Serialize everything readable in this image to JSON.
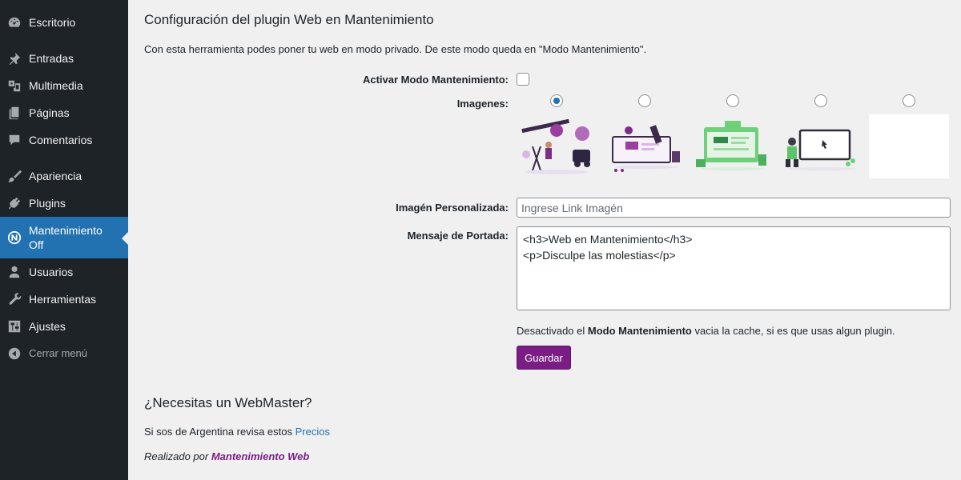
{
  "sidebar": {
    "items": [
      {
        "label": "Escritorio",
        "icon": "dashboard-icon"
      },
      {
        "label": "Entradas",
        "icon": "pin-icon"
      },
      {
        "label": "Multimedia",
        "icon": "media-icon"
      },
      {
        "label": "Páginas",
        "icon": "pages-icon"
      },
      {
        "label": "Comentarios",
        "icon": "comments-icon"
      },
      {
        "label": "Apariencia",
        "icon": "brush-icon"
      },
      {
        "label": "Plugins",
        "icon": "plugin-icon"
      },
      {
        "label": "Mantenimiento Off",
        "icon": "maintenance-icon"
      },
      {
        "label": "Usuarios",
        "icon": "users-icon"
      },
      {
        "label": "Herramientas",
        "icon": "wrench-icon"
      },
      {
        "label": "Ajustes",
        "icon": "settings-icon"
      },
      {
        "label": "Cerrar menú",
        "icon": "collapse-icon"
      }
    ],
    "active_color": "#2271b1"
  },
  "page": {
    "title": "Configuración del plugin Web en Mantenimiento",
    "description": "Con esta herramienta podes poner tu web en modo privado. De este modo queda en \"Modo Mantenimiento\".",
    "activate_label": "Activar Modo Mantenimiento:",
    "activate_checked": false,
    "images_label": "Imagenes:",
    "images": [
      {
        "name": "illustration-1",
        "selected": true
      },
      {
        "name": "illustration-2",
        "selected": false
      },
      {
        "name": "illustration-3",
        "selected": false
      },
      {
        "name": "illustration-4",
        "selected": false
      },
      {
        "name": "illustration-blank",
        "selected": false
      }
    ],
    "custom_image_label": "Imagén Personalizada:",
    "custom_image_placeholder": "Ingrese Link Imagén",
    "message_label": "Mensaje de Portada:",
    "message_value": "<h3>Web en Mantenimiento</h3>\n<p>Disculpe las molestias</p>",
    "note_prefix": "Desactivado el ",
    "note_bold": "Modo Mantenimiento",
    "note_suffix": " vacia la cache, si es que usas algun plugin.",
    "save_label": "Guardar",
    "button_color": "#7a1e85"
  },
  "footer": {
    "heading": "¿Necesitas un WebMaster?",
    "line1_prefix": "Si sos de Argentina revisa estos ",
    "line1_link": "Precios",
    "line2_prefix": "Realizado por ",
    "line2_link": "Mantenimiento Web"
  }
}
